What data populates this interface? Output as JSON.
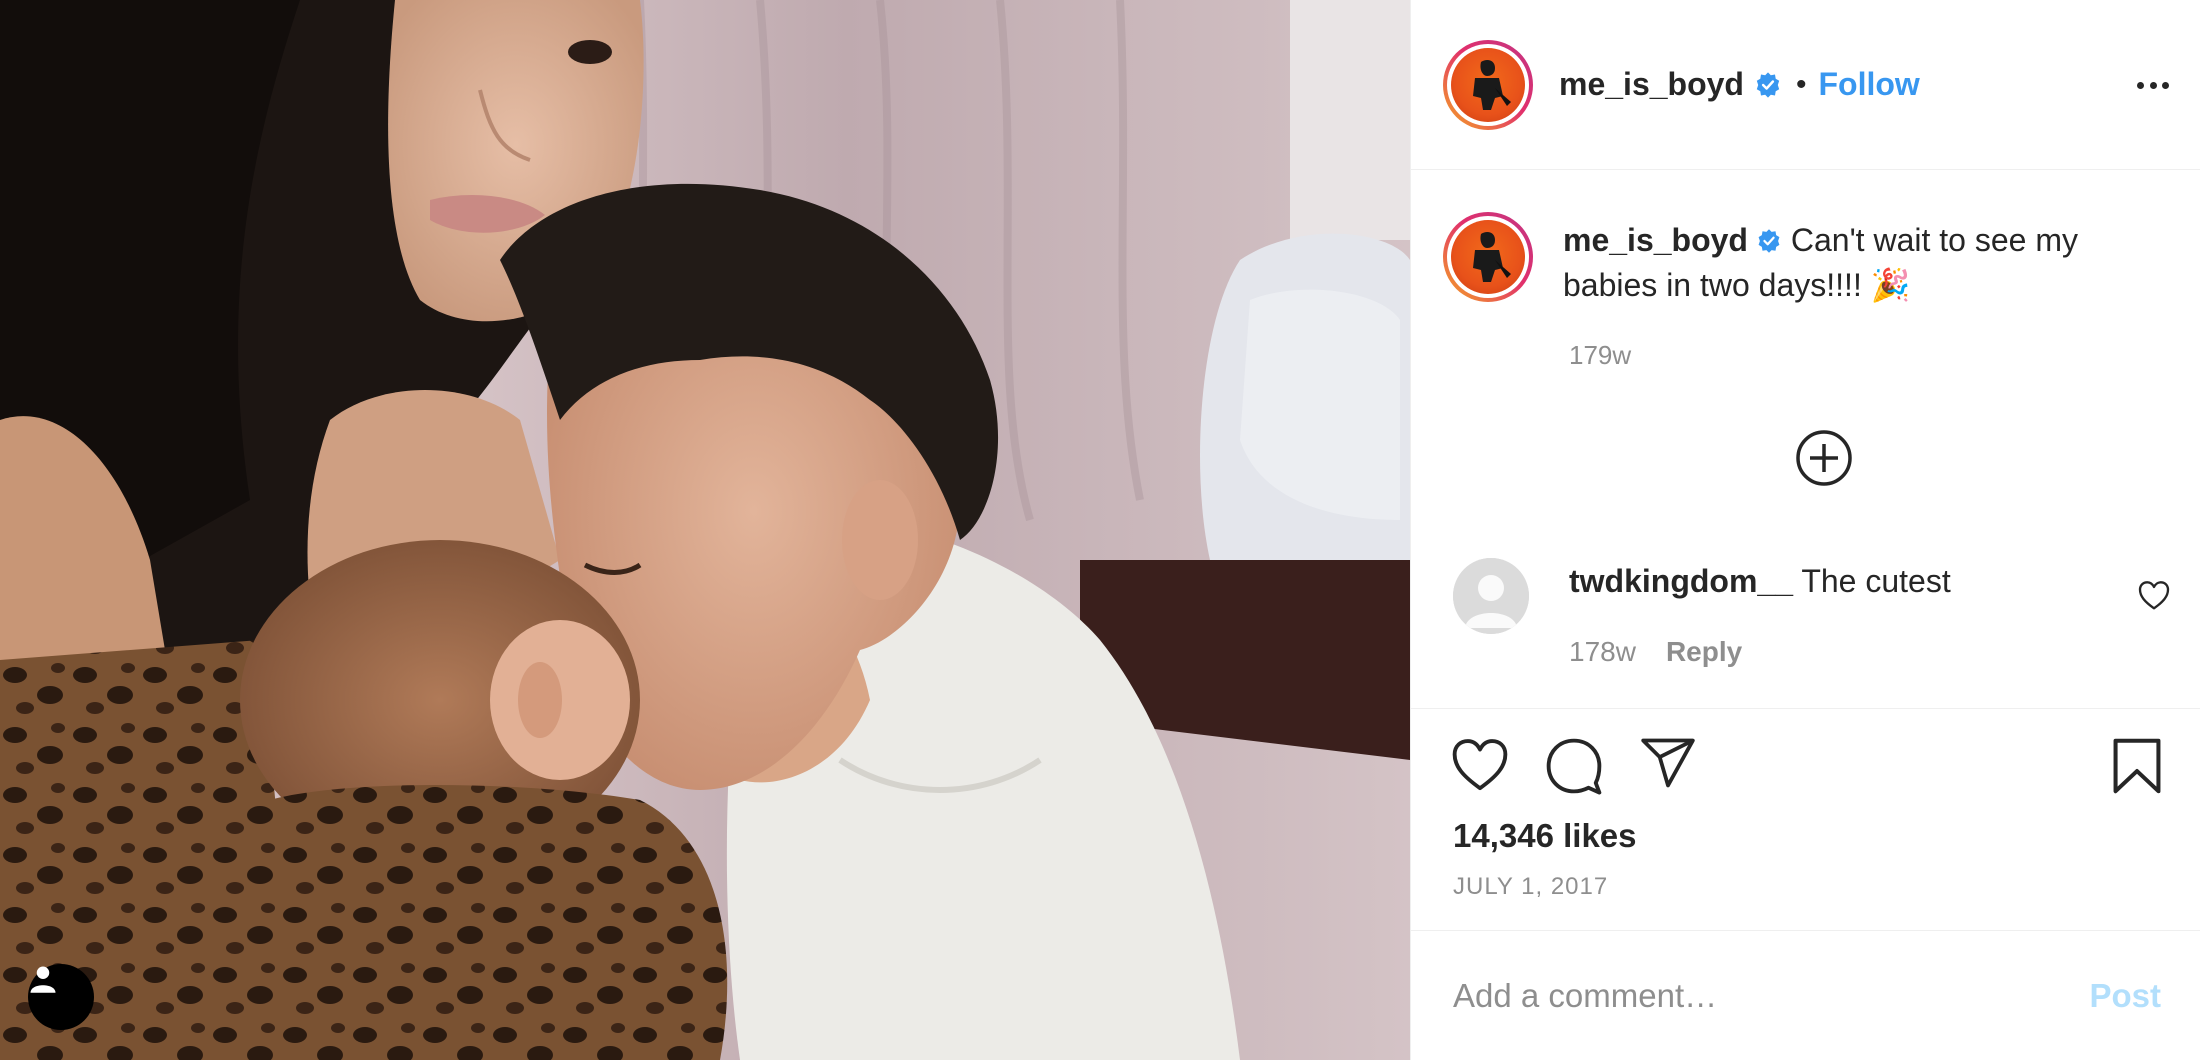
{
  "post": {
    "author": "me_is_boyd",
    "verified": true,
    "follow_label": "Follow",
    "separator": "•",
    "caption_text": " Can't wait to see my babies in two days!!!! 🎉",
    "caption_time": "179w",
    "likes": "14,346 likes",
    "date": "JULY 1, 2017"
  },
  "comments": [
    {
      "username": "twdkingdom__",
      "text": " The cutest",
      "time": "178w",
      "reply_label": "Reply"
    }
  ],
  "composer": {
    "placeholder": "Add a comment…",
    "post_label": "Post"
  },
  "colors": {
    "accent": "#3897f0",
    "post_disabled": "#b2dffc",
    "muted": "#8e8e8e",
    "text": "#262626"
  },
  "icons": {
    "more": "more-options-icon",
    "verified": "verified-badge-icon",
    "load_more": "plus-circle-icon",
    "like": "heart-icon",
    "comment": "comment-bubble-icon",
    "share": "paper-plane-icon",
    "save": "bookmark-icon",
    "user_tag": "person-icon"
  }
}
